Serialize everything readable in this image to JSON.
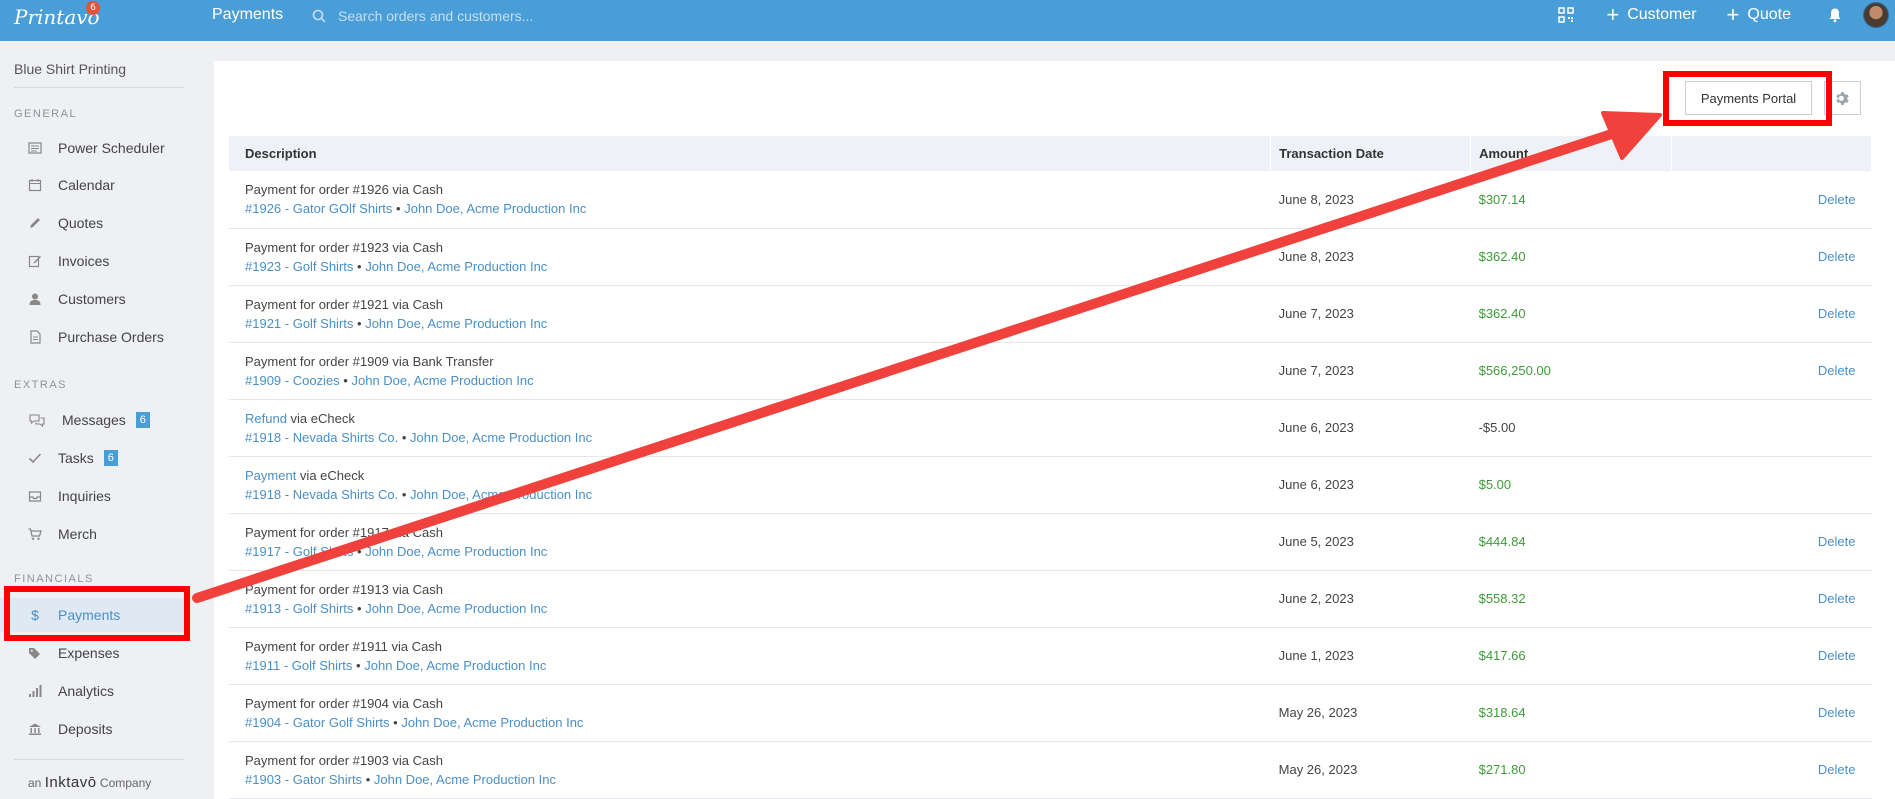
{
  "header": {
    "logo": "Printavo",
    "logo_badge": "6",
    "title": "Payments",
    "search_placeholder": "Search orders and customers...",
    "customer_label": "Customer",
    "quote_label": "Quote"
  },
  "sidebar": {
    "company": "Blue Shirt Printing",
    "sections": {
      "general": "GENERAL",
      "extras": "EXTRAS",
      "financials": "FINANCIALS"
    },
    "general": [
      "Power Scheduler",
      "Calendar",
      "Quotes",
      "Invoices",
      "Customers",
      "Purchase Orders"
    ],
    "extras": [
      {
        "label": "Messages",
        "badge": "6"
      },
      {
        "label": "Tasks",
        "badge": "6"
      },
      {
        "label": "Inquiries"
      },
      {
        "label": "Merch"
      }
    ],
    "financials": [
      "Payments",
      "Expenses",
      "Analytics",
      "Deposits"
    ],
    "footer_an": "an",
    "footer_brand": "Inktavō",
    "footer_company": "Company",
    "payments_icon": "$"
  },
  "toolbar": {
    "portal_label": "Payments Portal"
  },
  "table": {
    "headers": [
      "Description",
      "Transaction Date",
      "Amount",
      ""
    ],
    "delete_label": "Delete",
    "rows": [
      {
        "l1_link": "",
        "l1": "Payment for order #1926 via Cash",
        "order": "#1926 - Gator GOlf Shirts",
        "sep": "•",
        "customer": "John Doe, Acme Production Inc",
        "date": "June 8, 2023",
        "amount": "$307.14",
        "delete": true
      },
      {
        "l1_link": "",
        "l1": "Payment for order #1923 via Cash",
        "order": "#1923 - Golf Shirts",
        "sep": "•",
        "customer": "John Doe, Acme Production Inc",
        "date": "June 8, 2023",
        "amount": "$362.40",
        "delete": true
      },
      {
        "l1_link": "",
        "l1": "Payment for order #1921 via Cash",
        "order": "#1921 - Golf Shirts",
        "sep": "•",
        "customer": "John Doe, Acme Production Inc",
        "date": "June 7, 2023",
        "amount": "$362.40",
        "delete": true
      },
      {
        "l1_link": "",
        "l1": "Payment for order #1909 via Bank Transfer",
        "order": "#1909 - Coozies",
        "sep": "•",
        "customer": "John Doe, Acme Production Inc",
        "date": "June 7, 2023",
        "amount": "$566,250.00",
        "delete": true
      },
      {
        "l1_link": "Refund",
        "l1": " via eCheck",
        "order": "#1918 - Nevada Shirts Co.",
        "sep": "•",
        "customer": "John Doe, Acme Production Inc",
        "date": "June 6, 2023",
        "amount": "-$5.00",
        "negative": true,
        "delete": false
      },
      {
        "l1_link": "Payment",
        "l1": " via eCheck",
        "order": "#1918 - Nevada Shirts Co.",
        "sep": "•",
        "customer": "John Doe, Acme Production Inc",
        "date": "June 6, 2023",
        "amount": "$5.00",
        "delete": false
      },
      {
        "l1_link": "",
        "l1": "Payment for order #1917 via Cash",
        "order": "#1917 - Golf Shirts",
        "sep": "•",
        "customer": "John Doe, Acme Production Inc",
        "date": "June 5, 2023",
        "amount": "$444.84",
        "delete": true
      },
      {
        "l1_link": "",
        "l1": "Payment for order #1913 via Cash",
        "order": "#1913 - Golf Shirts",
        "sep": "•",
        "customer": "John Doe, Acme Production Inc",
        "date": "June 2, 2023",
        "amount": "$558.32",
        "delete": true
      },
      {
        "l1_link": "",
        "l1": "Payment for order #1911 via Cash",
        "order": "#1911 - Golf Shirts",
        "sep": "•",
        "customer": "John Doe, Acme Production Inc",
        "date": "June 1, 2023",
        "amount": "$417.66",
        "delete": true
      },
      {
        "l1_link": "",
        "l1": "Payment for order #1904 via Cash",
        "order": "#1904 - Gator Golf Shirts",
        "sep": "•",
        "customer": "John Doe, Acme Production Inc",
        "date": "May 26, 2023",
        "amount": "$318.64",
        "delete": true
      },
      {
        "l1_link": "",
        "l1": "Payment for order #1903 via Cash",
        "order": "#1903 - Gator Shirts",
        "sep": "•",
        "customer": "John Doe, Acme Production Inc",
        "date": "May 26, 2023",
        "amount": "$271.80",
        "delete": true
      }
    ]
  },
  "colors": {
    "header": "#4a9ed8",
    "link": "#4a8fc7",
    "amount": "#3f9b3a",
    "annotation": "#ff0000"
  }
}
